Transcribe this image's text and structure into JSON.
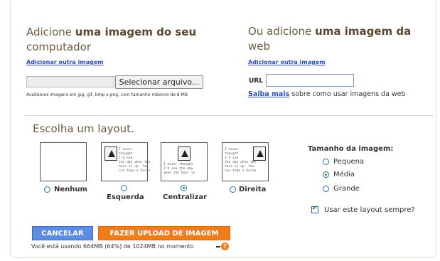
{
  "computer": {
    "title_prefix": "Adicione ",
    "title_bold": "uma imagem do seu",
    "title_line2": "computador",
    "add_another": "Adicionar outra imagem",
    "choose_file": "Selecionar arquivo...",
    "accepted_note": "Aceitamos imagens em jpg, gif, bmp e png, com tamanho máximo de 8 MB"
  },
  "web": {
    "title_prefix": "Ou adicione ",
    "title_bold": "uma imagem da",
    "title_line2": "web",
    "add_another": "Adicionar outra imagem",
    "url_label": "URL",
    "url_value": "",
    "learn_more": "Saiba mais",
    "learn_more_rest": " sobre como usar imagens da web"
  },
  "layout": {
    "title": "Escolha um layout.",
    "sample_text_1": "I never\nthought\nI'd see\nthe day when the\nhour is up. You\ncan take a horse",
    "sample_text_2": "I never thought\nI'd see the day\nwhen the hour is",
    "options": [
      {
        "label": "Nenhum",
        "selected": false
      },
      {
        "label": "Esquerda",
        "selected": false
      },
      {
        "label": "Centralizar",
        "selected": true
      },
      {
        "label": "Direita",
        "selected": false
      }
    ]
  },
  "size": {
    "title": "Tamanho da imagem:",
    "options": [
      {
        "label": "Pequena",
        "selected": false
      },
      {
        "label": "Média",
        "selected": true
      },
      {
        "label": "Grande",
        "selected": false
      }
    ],
    "always_label": "Usar este layout sempre?",
    "always_checked": true
  },
  "actions": {
    "cancel": "CANCELAR",
    "upload": "FAZER UPLOAD DE IMAGEM",
    "usage": "Você está usando 664MB (64%) de 1024MB no momento",
    "help": "?"
  },
  "colors": {
    "cancel_bg": "#5c8de2",
    "upload_bg": "#f07d1a",
    "link": "#2a4fbf",
    "heading": "#6b5a3f"
  }
}
